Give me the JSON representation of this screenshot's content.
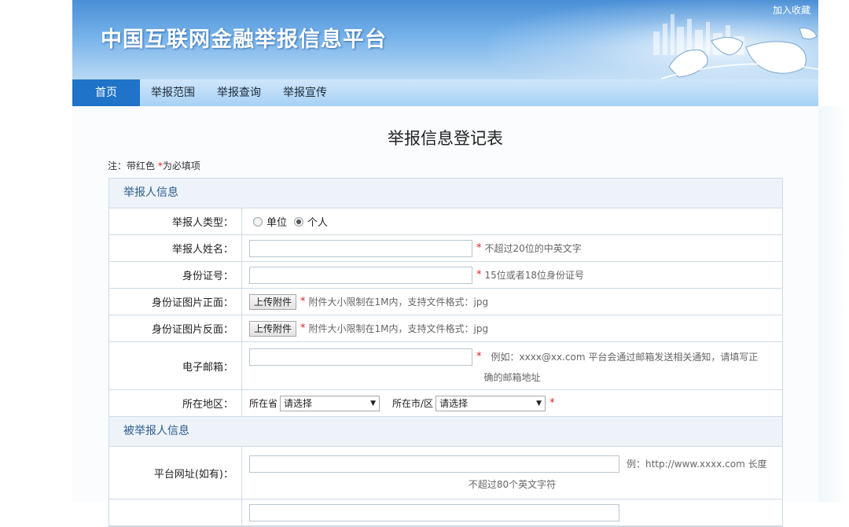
{
  "header": {
    "title": "中国互联网金融举报信息平台",
    "bookmark": "加入收藏"
  },
  "nav": {
    "items": [
      "首页",
      "举报范围",
      "举报查询",
      "举报宣传"
    ],
    "active_index": 0
  },
  "form": {
    "title": "举报信息登记表",
    "note_prefix": "注：带红色 ",
    "note_star": "*",
    "note_suffix": "为必填项",
    "sections": {
      "reporter": "举报人信息",
      "reported": "被举报人信息"
    },
    "rows": {
      "type": {
        "label": "举报人类型：",
        "options": [
          "单位",
          "个人"
        ],
        "selected": "个人"
      },
      "name": {
        "label": "举报人姓名：",
        "value": "",
        "hint": "不超过20位的中英文字"
      },
      "id_number": {
        "label": "身份证号：",
        "value": "",
        "hint": "15位或者18位身份证号"
      },
      "id_front": {
        "label": "身份证图片正面：",
        "button": "上传附件",
        "hint": "附件大小限制在1M内，支持文件格式：jpg"
      },
      "id_back": {
        "label": "身份证图片反面：",
        "button": "上传附件",
        "hint": "附件大小限制在1M内，支持文件格式：jpg"
      },
      "email": {
        "label": "电子邮箱：",
        "value": "",
        "hint_line1": "例如：xxxx@xx.com 平台会通过邮箱发送相关通知，请填写正",
        "hint_line2": "确的邮箱地址"
      },
      "region": {
        "label": "所在地区：",
        "province_label": "所在省",
        "province_value": "请选择",
        "city_label": "所在市/区",
        "city_value": "请选择"
      },
      "website": {
        "label": "平台网址(如有)：",
        "value": "",
        "hint_line1": "例：http://www.xxxx.com 长度",
        "hint_line2": "不超过80个英文字符"
      }
    },
    "required_mark": "*"
  },
  "colors": {
    "accent": "#1f73c8",
    "required": "#e02020",
    "section_text": "#2e5e8e"
  }
}
